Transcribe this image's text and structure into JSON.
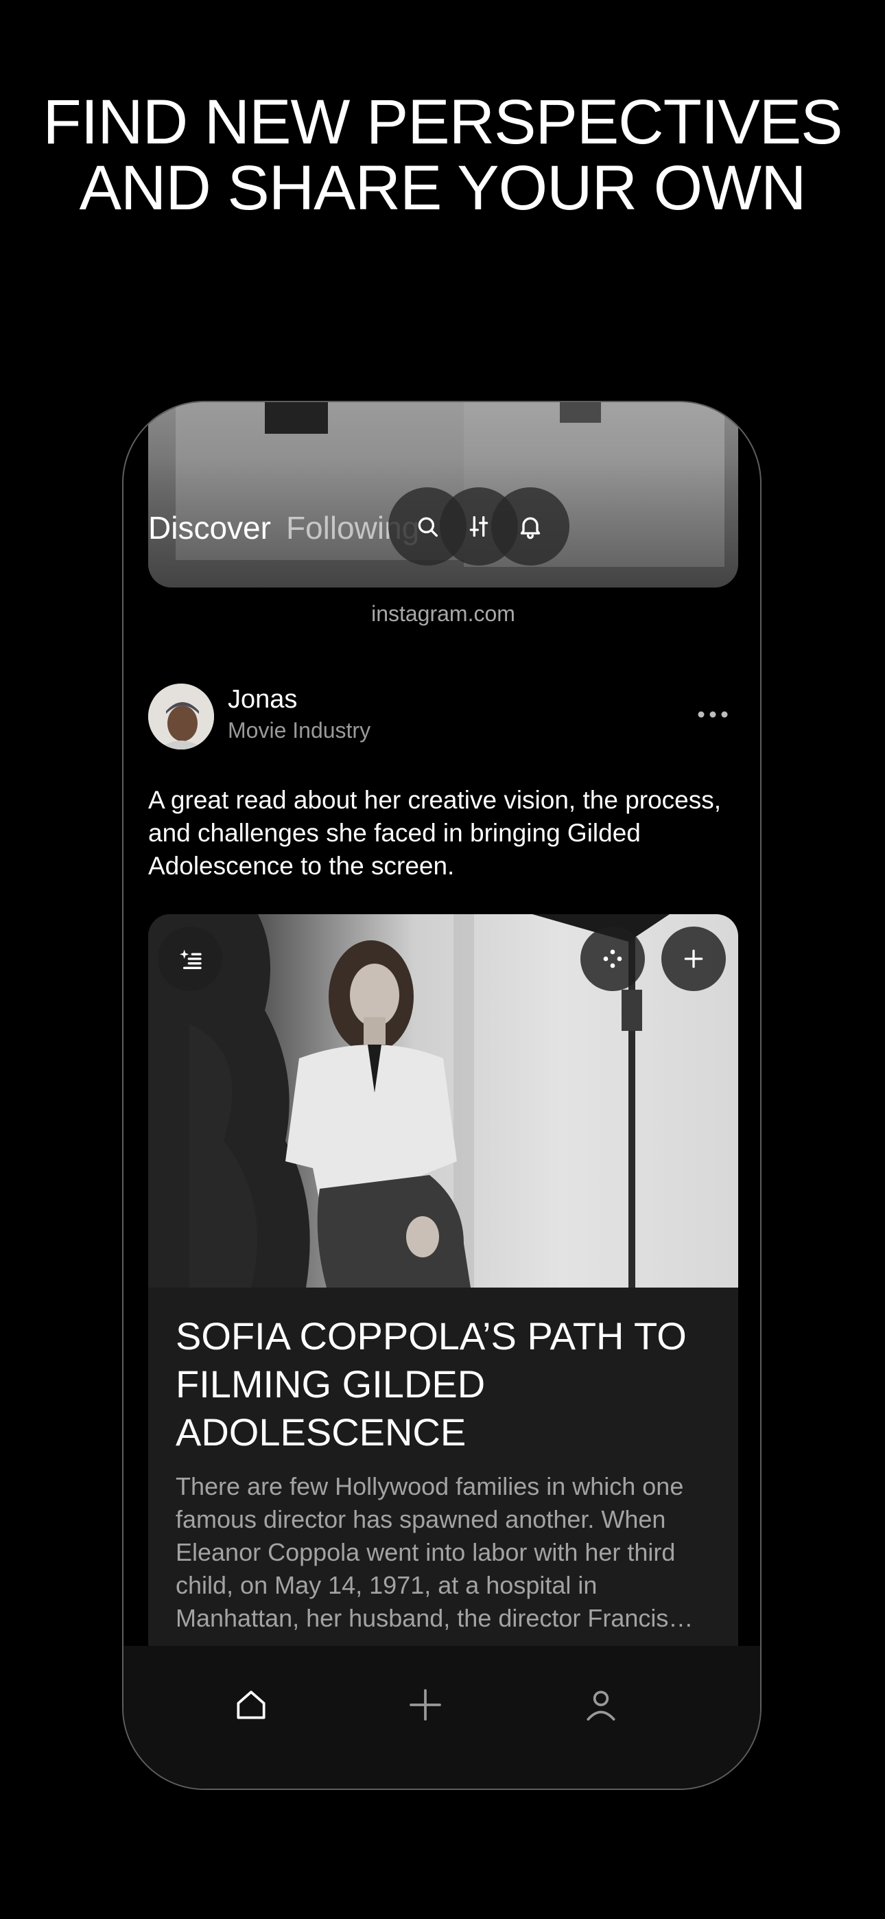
{
  "headline": {
    "line1": "FIND NEW PERSPECTIVES",
    "line2": "AND SHARE YOUR OWN"
  },
  "nav": {
    "tabs": [
      {
        "label": "Discover",
        "active": true
      },
      {
        "label": "Following",
        "active": false
      }
    ],
    "actions": [
      {
        "icon": "search-icon"
      },
      {
        "icon": "filter-sliders-icon"
      },
      {
        "icon": "bell-icon"
      }
    ]
  },
  "source": "instagram.com",
  "post": {
    "author": "Jonas",
    "subtitle": "Movie Industry",
    "text": "A great read about her creative vision, the process, and challenges she faced in bringing Gilded Adolescence to the screen.",
    "more_icon": "more-dots-icon"
  },
  "article": {
    "title": "SOFIA COPPOLA’S PATH TO FILMING GILDED ADOLESCENCE",
    "description": "There are few Hollywood families in which one famous director has spawned another. When Eleanor Coppola went into labor with her third child, on May 14, 1971, at a hospital in Manhattan, her husband, the director Francis…",
    "image_actions": [
      {
        "icon": "ai-summary-icon"
      },
      {
        "icon": "scatter-dots-icon"
      },
      {
        "icon": "plus-icon"
      }
    ]
  },
  "tabbar": {
    "items": [
      {
        "icon": "home-icon"
      },
      {
        "icon": "plus-icon"
      },
      {
        "icon": "profile-icon"
      }
    ]
  },
  "colors": {
    "background": "#000000",
    "text": "#ffffff",
    "muted": "#a3a3a3",
    "card": "#1c1c1c"
  }
}
